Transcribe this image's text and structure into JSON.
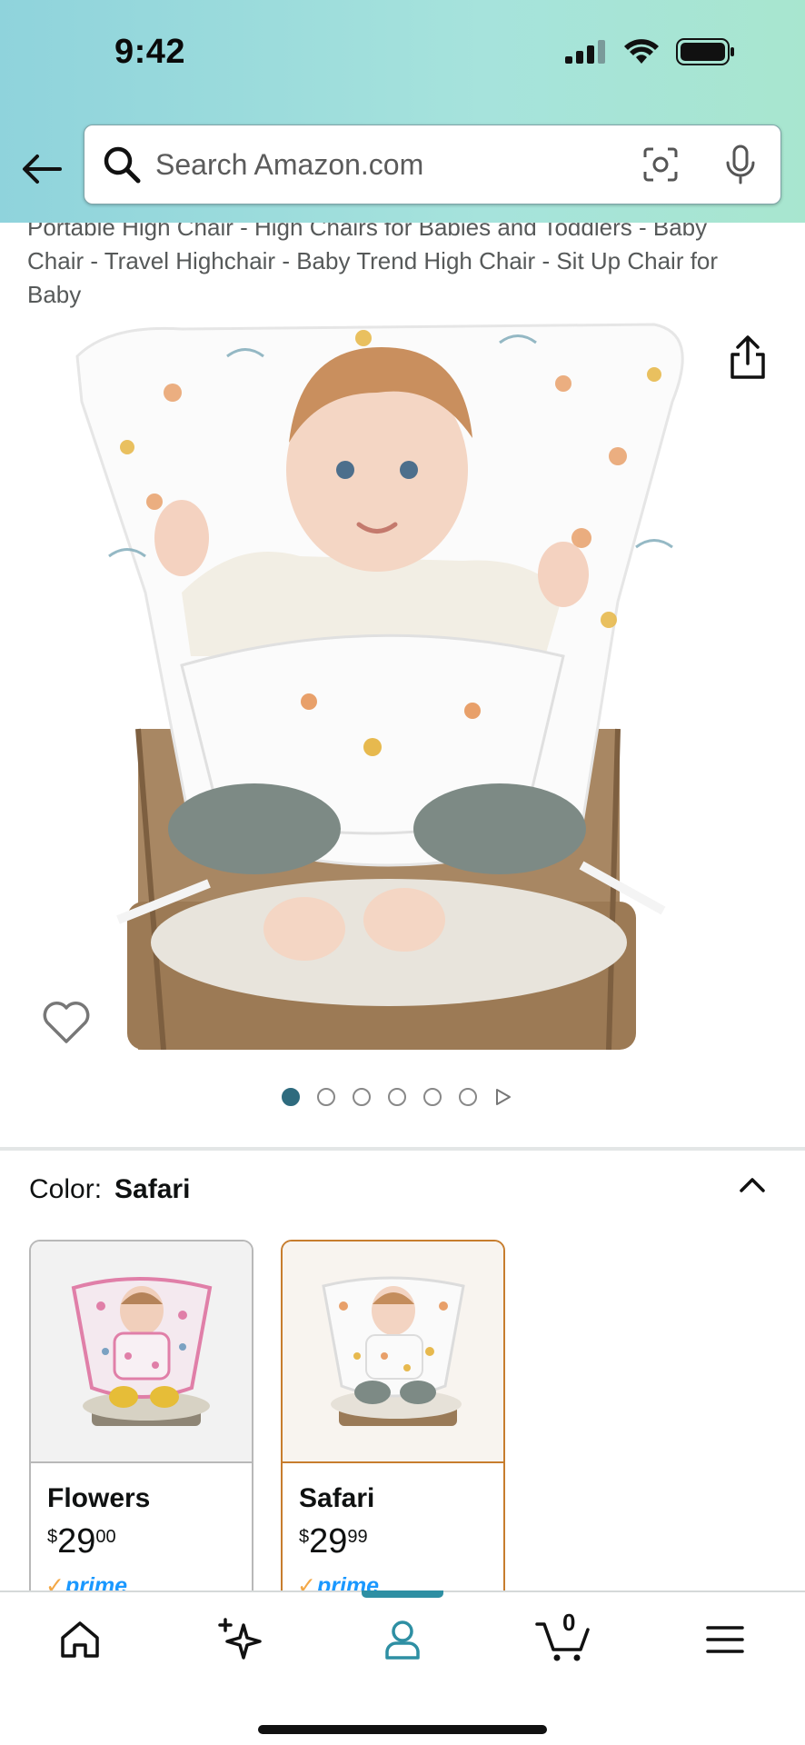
{
  "status_bar": {
    "time": "9:42"
  },
  "search": {
    "placeholder": "Search Amazon.com"
  },
  "product": {
    "title": "Portable High Chair - High Chairs for Babies and Toddlers - Baby Chair - Travel Highchair - Baby Trend High Chair - Sit Up Chair for Baby",
    "image_count": 6,
    "active_image_index": 0
  },
  "variation": {
    "label": "Color:",
    "selected": "Safari",
    "options": [
      {
        "name": "Flowers",
        "price_symbol": "$",
        "price_whole": "29",
        "price_fraction": "00",
        "prime": "prime"
      },
      {
        "name": "Safari",
        "price_symbol": "$",
        "price_whole": "29",
        "price_fraction": "99",
        "prime": "prime"
      }
    ]
  },
  "nav": {
    "cart_count": "0",
    "items": [
      "home-icon",
      "ai-sparkle-icon",
      "account-icon",
      "cart-icon",
      "menu-icon"
    ],
    "active": "account-icon"
  },
  "colors": {
    "header_gradient_start": "#8fd3dc",
    "header_gradient_end": "#a8e6cf",
    "accent": "#2e8fa3",
    "prime_blue": "#1a98ff",
    "selected_border": "#c77d2e"
  }
}
